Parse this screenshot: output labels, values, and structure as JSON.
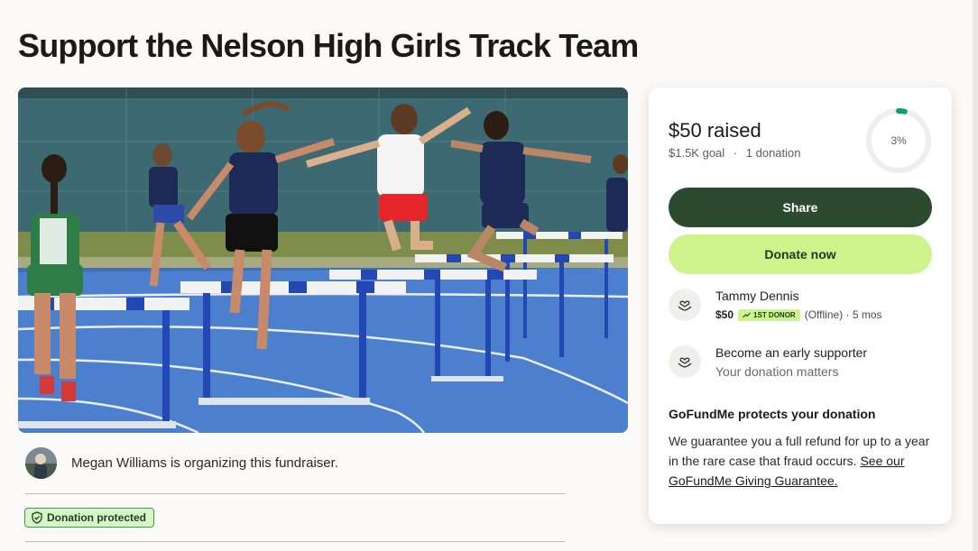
{
  "page": {
    "title": "Support the Nelson High Girls Track Team"
  },
  "organizer": {
    "text": "Megan Williams is organizing this fundraiser."
  },
  "badge": {
    "label": "Donation protected"
  },
  "progress": {
    "raised": "$50 raised",
    "goal": "$1.5K goal",
    "donations": "1 donation",
    "separator": "·",
    "percent_label": "3%",
    "percent_value": 0.033
  },
  "buttons": {
    "share": "Share",
    "donate": "Donate now"
  },
  "donor": {
    "name": "Tammy Dennis",
    "amount": "$50",
    "badge": "1ST DONOR",
    "status": "(Offline) · 5 mos"
  },
  "supporter": {
    "title": "Become an early supporter",
    "subtitle": "Your donation matters"
  },
  "protection": {
    "title": "GoFundMe protects your donation",
    "body": "We guarantee you a full refund for up to a year in the rare case that fraud occurs.",
    "link": "See our GoFundMe Giving Guarantee."
  },
  "colors": {
    "share_button": "#2b4a2f",
    "donate_button": "#cdf38d",
    "progress_ring": "#02a95c",
    "badge_bg": "#d8f5c4"
  },
  "icons": {
    "donor": "heart-hands-icon",
    "supporter": "heart-hands-icon",
    "badge": "shield-check-icon"
  }
}
